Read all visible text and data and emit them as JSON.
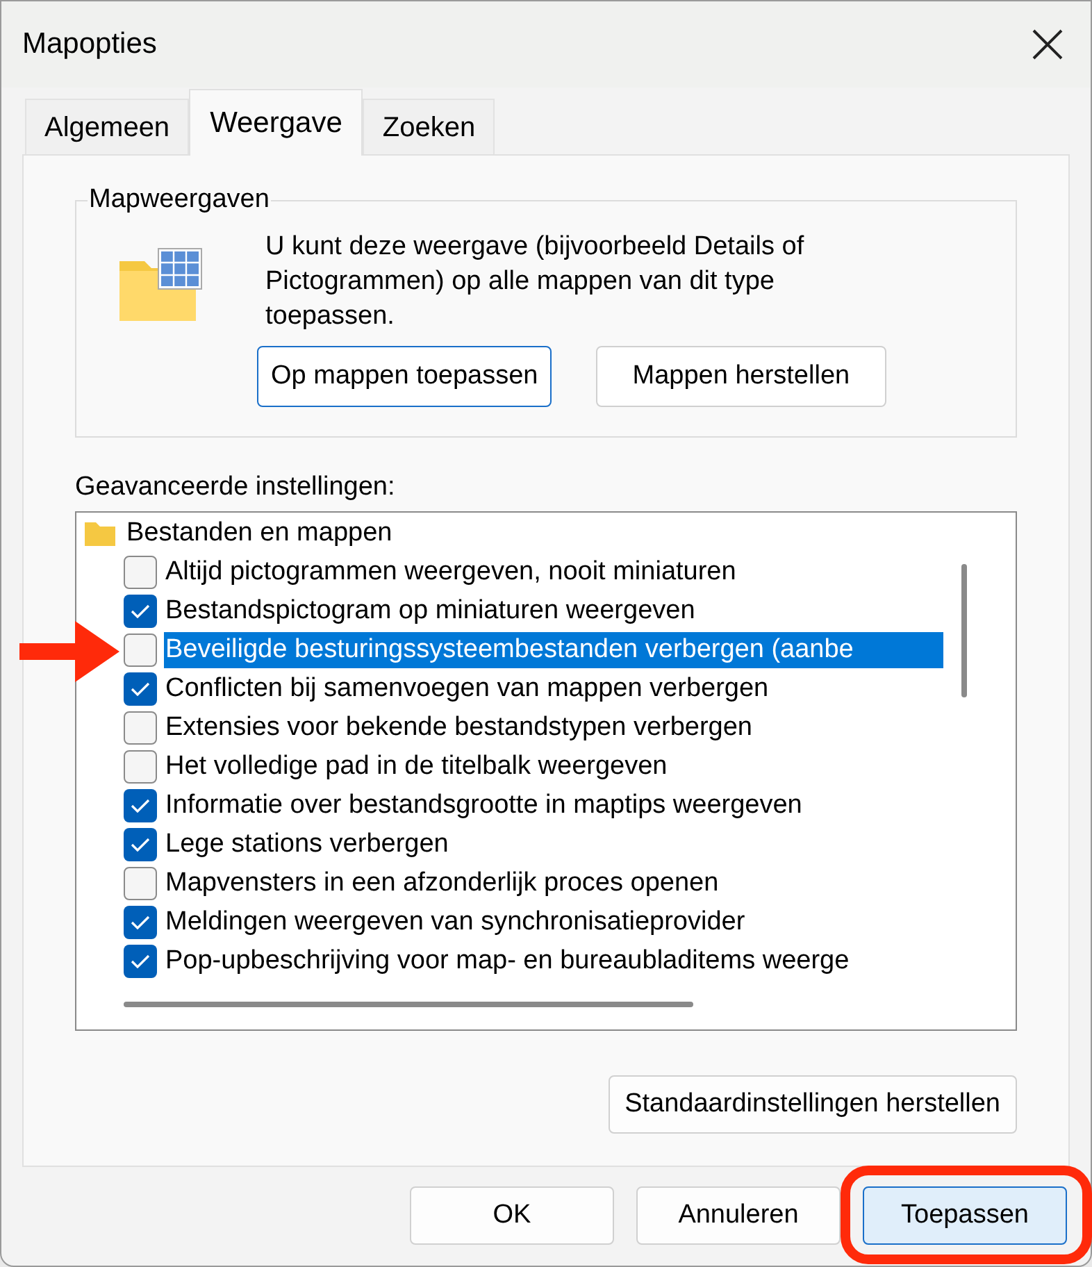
{
  "window": {
    "title": "Mapopties"
  },
  "tabs": [
    {
      "label": "Algemeen",
      "selected": false
    },
    {
      "label": "Weergave",
      "selected": true
    },
    {
      "label": "Zoeken",
      "selected": false
    }
  ],
  "folder_views": {
    "title": "Mapweergaven",
    "description": "U kunt deze weergave (bijvoorbeeld Details of Pictogrammen) op alle mappen van dit type toepassen.",
    "buttons": [
      {
        "label": "Op mappen toepassen",
        "focused": true
      },
      {
        "label": "Mappen herstellen",
        "focused": false
      }
    ]
  },
  "advanced": {
    "label": "Geavanceerde instellingen:",
    "group": "Bestanden en mappen",
    "items": [
      {
        "label": "Altijd pictogrammen weergeven, nooit miniaturen",
        "checked": false,
        "selected": false
      },
      {
        "label": "Bestandspictogram op miniaturen weergeven",
        "checked": true,
        "selected": false
      },
      {
        "label": "Beveiligde besturingssysteembestanden verbergen (aanbe",
        "checked": false,
        "selected": true
      },
      {
        "label": "Conflicten bij samenvoegen van mappen verbergen",
        "checked": true,
        "selected": false
      },
      {
        "label": "Extensies voor bekende bestandstypen verbergen",
        "checked": false,
        "selected": false
      },
      {
        "label": "Het volledige pad in de titelbalk weergeven",
        "checked": false,
        "selected": false
      },
      {
        "label": "Informatie over bestandsgrootte in maptips weergeven",
        "checked": true,
        "selected": false
      },
      {
        "label": "Lege stations verbergen",
        "checked": true,
        "selected": false
      },
      {
        "label": "Mapvensters in een afzonderlijk proces openen",
        "checked": false,
        "selected": false
      },
      {
        "label": "Meldingen weergeven van synchronisatieprovider",
        "checked": true,
        "selected": false
      },
      {
        "label": "Pop-upbeschrijving voor map- en bureaubladitems weerge",
        "checked": true,
        "selected": false
      }
    ],
    "restore_button": "Standaardinstellingen herstellen"
  },
  "footer_buttons": [
    {
      "label": "OK",
      "highlighted": false
    },
    {
      "label": "Annuleren",
      "highlighted": false
    },
    {
      "label": "Toepassen",
      "highlighted": true
    }
  ]
}
